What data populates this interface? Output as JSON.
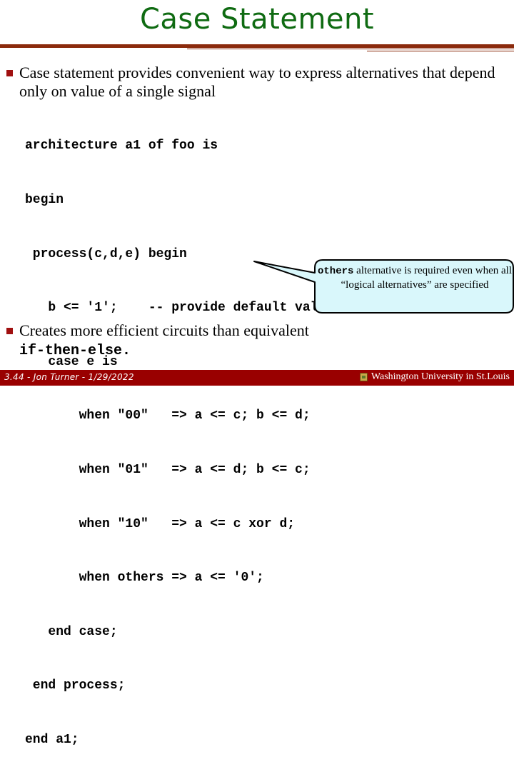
{
  "slide": {
    "title": "Case Statement",
    "bullets": [
      {
        "text": "Case statement provides convenient way to express alternatives that depend only on value of a single signal"
      },
      {
        "text": "Creates more efficient circuits than equivalent",
        "code_suffix": "if-then-else."
      }
    ],
    "code_lines": [
      "architecture a1 of foo is",
      "begin",
      " process(c,d,e) begin",
      "   b <= '1';    -- provide default value for b",
      "   case e is",
      "       when \"00\"   => a <= c; b <= d;",
      "       when \"01\"   => a <= d; b <= c;",
      "       when \"10\"   => a <= c xor d;",
      "       when others => a <= '0';",
      "   end case;",
      " end process;",
      "end a1;"
    ],
    "callout": {
      "keyword": "others",
      "text": " alternative is required even when all “logical alternatives” are specified",
      "fill_color": "#d9f7fb",
      "border_color": "#000000"
    },
    "footer": {
      "left": "3.44 - Jon Turner - 1/29/2022",
      "right": "Washington University in St.Louis",
      "logo_icon": "university-shield-icon",
      "background_color": "#990000"
    },
    "colors": {
      "title": "#0f6b12",
      "rule": "#8b2a0c",
      "bullet": "#a01010"
    }
  }
}
